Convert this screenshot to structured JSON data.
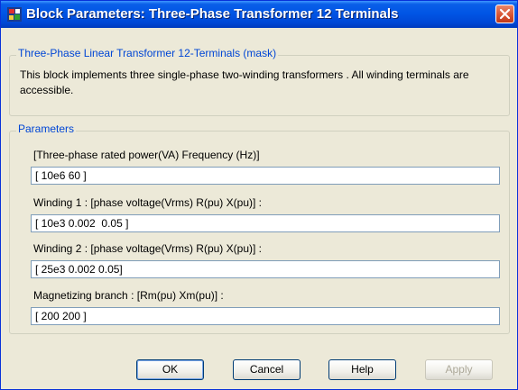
{
  "window": {
    "title": "Block Parameters: Three-Phase Transformer 12 Terminals",
    "icon": "simulink-block-icon",
    "close_icon": "close-icon"
  },
  "mask_group": {
    "legend": "Three-Phase Linear Transformer 12-Terminals (mask)",
    "description": "This block implements three single-phase two-winding transformers . All winding terminals are accessible."
  },
  "parameters_group": {
    "legend": "Parameters",
    "fields": [
      {
        "label": "[Three-phase rated power(VA)  Frequency (Hz)]",
        "value": "[ 10e6 60 ]"
      },
      {
        "label": "Winding 1 : [phase voltage(Vrms)  R(pu)  X(pu)] :",
        "value": "[ 10e3 0.002  0.05 ]"
      },
      {
        "label": "Winding 2 : [phase voltage(Vrms)  R(pu)  X(pu)] :",
        "value": "[ 25e3 0.002 0.05]"
      },
      {
        "label": "Magnetizing branch : [Rm(pu)  Xm(pu)] :",
        "value": "[ 200 200 ]"
      }
    ]
  },
  "buttons": {
    "ok": "OK",
    "cancel": "Cancel",
    "help": "Help",
    "apply": "Apply"
  },
  "colors": {
    "titlebar": "#0055e5",
    "legend_text": "#0046d5",
    "close_button": "#d6512f"
  }
}
